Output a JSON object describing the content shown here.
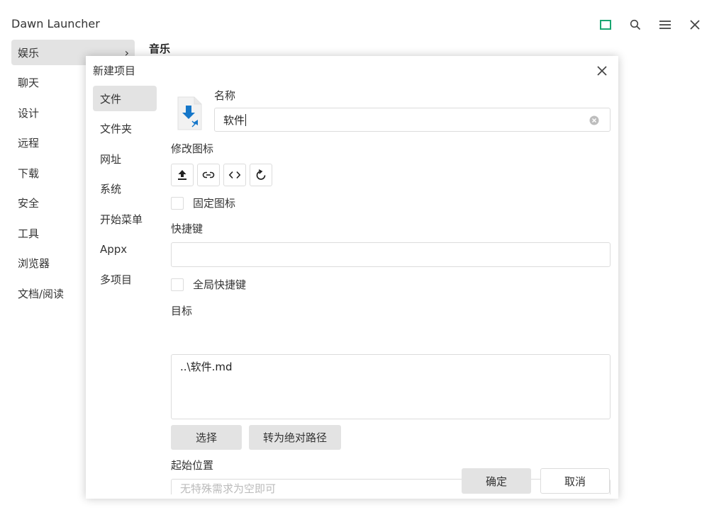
{
  "app": {
    "title": "Dawn Launcher"
  },
  "colors": {
    "accent": "#1aa672",
    "active_bg": "#e3e3e3",
    "border": "#dcdcdc",
    "file_icon_blue": "#1677c9"
  },
  "window_controls": [
    {
      "name": "layout-toggle",
      "icon": "green-square-icon"
    },
    {
      "name": "search",
      "icon": "search-icon"
    },
    {
      "name": "menu",
      "icon": "hamburger-menu-icon"
    },
    {
      "name": "close",
      "icon": "close-icon"
    }
  ],
  "sidebar": {
    "items": [
      {
        "label": "娱乐",
        "active": true,
        "chevron": "›"
      },
      {
        "label": "聊天"
      },
      {
        "label": "设计"
      },
      {
        "label": "远程"
      },
      {
        "label": "下载"
      },
      {
        "label": "安全"
      },
      {
        "label": "工具"
      },
      {
        "label": "浏览器"
      },
      {
        "label": "文档/阅读"
      }
    ]
  },
  "subgroup": {
    "title": "音乐"
  },
  "dialog": {
    "title": "新建项目",
    "types": [
      {
        "label": "文件",
        "active": true
      },
      {
        "label": "文件夹"
      },
      {
        "label": "网址"
      },
      {
        "label": "系统"
      },
      {
        "label": "开始菜单"
      },
      {
        "label": "Appx"
      },
      {
        "label": "多项目"
      }
    ],
    "name_label": "名称",
    "name_value": "软件",
    "modify_icon_label": "修改图标",
    "icon_buttons": [
      "upload-icon",
      "link-icon",
      "code-icon",
      "refresh-icon"
    ],
    "fixed_icon_label": "固定图标",
    "shortcut_label": "快捷键",
    "shortcut_value": "",
    "global_shortcut_label": "全局快捷键",
    "target_label": "目标",
    "target_value": "..\\软件.md",
    "choose_button": "选择",
    "absolute_path_button": "转为绝对路径",
    "start_location_label": "起始位置",
    "start_location_placeholder": "无特殊需求为空即可",
    "ok_button": "确定",
    "cancel_button": "取消"
  }
}
